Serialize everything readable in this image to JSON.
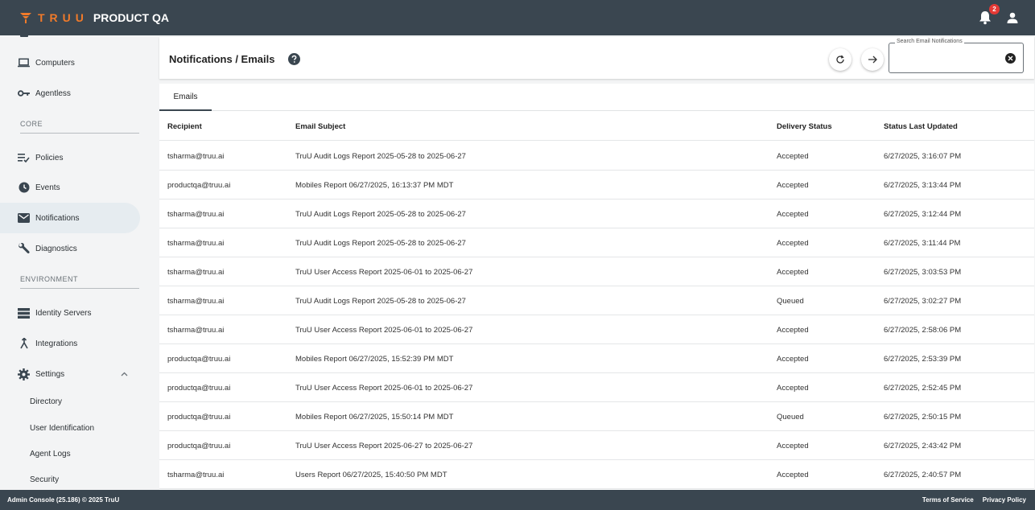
{
  "app": {
    "logo_text": "TRUU",
    "name": "PRODUCT QA",
    "notification_count": "2"
  },
  "sidebar": {
    "items": [
      {
        "label": "Computers",
        "icon": "laptop-icon"
      },
      {
        "label": "Agentless",
        "icon": "key-icon"
      },
      {
        "label": "Policies",
        "icon": "policy-list-icon"
      },
      {
        "label": "Events",
        "icon": "clock-icon"
      },
      {
        "label": "Notifications",
        "icon": "mail-icon",
        "active": true
      },
      {
        "label": "Diagnostics",
        "icon": "wrench-icon"
      },
      {
        "label": "Identity Servers",
        "icon": "server-icon"
      },
      {
        "label": "Integrations",
        "icon": "merge-icon"
      },
      {
        "label": "Settings",
        "icon": "gear-icon",
        "expanded": true
      }
    ],
    "sections": {
      "core": "CORE",
      "environment": "ENVIRONMENT"
    },
    "settings_subitems": [
      "Directory",
      "User Identification",
      "Agent Logs",
      "Security"
    ]
  },
  "header": {
    "title": "Notifications / Emails",
    "search_label": "Search Email Notifications",
    "search_value": ""
  },
  "tabs": [
    "Emails"
  ],
  "table": {
    "columns": [
      "Recipient",
      "Email Subject",
      "Delivery Status",
      "Status Last Updated"
    ],
    "rows": [
      [
        "tsharma@truu.ai",
        "TruU Audit Logs Report 2025-05-28 to 2025-06-27",
        "Accepted",
        "6/27/2025, 3:16:07 PM"
      ],
      [
        "productqa@truu.ai",
        "Mobiles Report 06/27/2025, 16:13:37 PM MDT",
        "Accepted",
        "6/27/2025, 3:13:44 PM"
      ],
      [
        "tsharma@truu.ai",
        "TruU Audit Logs Report 2025-05-28 to 2025-06-27",
        "Accepted",
        "6/27/2025, 3:12:44 PM"
      ],
      [
        "tsharma@truu.ai",
        "TruU Audit Logs Report 2025-05-28 to 2025-06-27",
        "Accepted",
        "6/27/2025, 3:11:44 PM"
      ],
      [
        "tsharma@truu.ai",
        "TruU User Access Report 2025-06-01 to 2025-06-27",
        "Accepted",
        "6/27/2025, 3:03:53 PM"
      ],
      [
        "tsharma@truu.ai",
        "TruU Audit Logs Report 2025-05-28 to 2025-06-27",
        "Queued",
        "6/27/2025, 3:02:27 PM"
      ],
      [
        "tsharma@truu.ai",
        "TruU User Access Report 2025-06-01 to 2025-06-27",
        "Accepted",
        "6/27/2025, 2:58:06 PM"
      ],
      [
        "productqa@truu.ai",
        "Mobiles Report 06/27/2025, 15:52:39 PM MDT",
        "Accepted",
        "6/27/2025, 2:53:39 PM"
      ],
      [
        "productqa@truu.ai",
        "TruU User Access Report 2025-06-01 to 2025-06-27",
        "Accepted",
        "6/27/2025, 2:52:45 PM"
      ],
      [
        "productqa@truu.ai",
        "Mobiles Report 06/27/2025, 15:50:14 PM MDT",
        "Queued",
        "6/27/2025, 2:50:15 PM"
      ],
      [
        "productqa@truu.ai",
        "TruU User Access Report 2025-06-27 to 2025-06-27",
        "Accepted",
        "6/27/2025, 2:43:42 PM"
      ],
      [
        "tsharma@truu.ai",
        "Users Report 06/27/2025, 15:40:50 PM MDT",
        "Accepted",
        "6/27/2025, 2:40:57 PM"
      ]
    ]
  },
  "footer": {
    "copyright": "Admin Console (25.186) © 2025 TruU",
    "terms": "Terms of Service",
    "privacy": "Privacy Policy"
  },
  "colors": {
    "topbar": "#3a4650",
    "brand_orange": "#f07a2a",
    "badge_red": "#e53935",
    "active_item_bg": "#e6ecf0"
  }
}
